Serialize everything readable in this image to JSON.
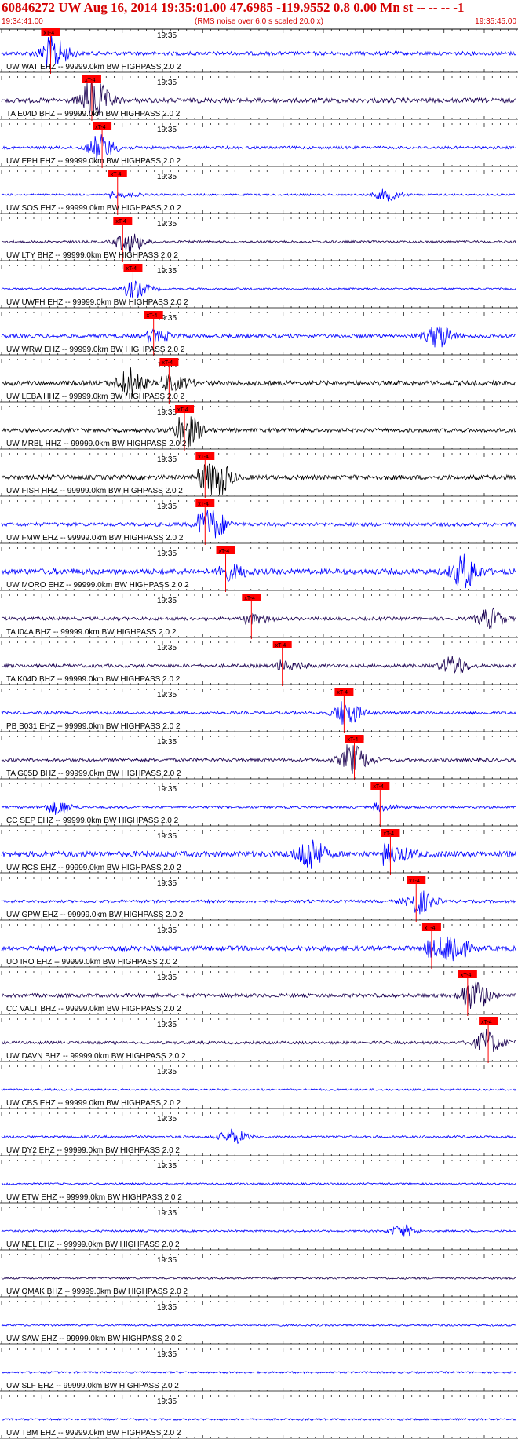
{
  "header": {
    "title": "60846272 UW Aug 16, 2014 19:35:01.00   47.6985 -119.9552  0.8 0.00 Mn st -- -- --  -1",
    "start_time": "19:34:41.00",
    "end_time": "19:35:45.00",
    "scale_note": "(RMS noise over 6.0 s scaled 20.0 x)"
  },
  "colors": {
    "header_text": "#d40000",
    "blue": "#0000ff",
    "dark": "#1a0050",
    "black": "#000000",
    "pick": "#ff0000"
  },
  "chart_data": {
    "type": "line",
    "title": "60846272 UW Aug 16, 2014 19:35:01.00   47.6985 -119.9552  0.8 0.00 Mn st -- -- --  -1",
    "x_start": "19:34:41.00",
    "x_end": "19:35:45.00",
    "x_label_per_trace": "19:35",
    "pick_label": "xT-4",
    "traces": [
      {
        "label": "UW WAT EHZ -- 99999.0km BW  HIGHPASS  2.0  2",
        "color": "blue",
        "pick": 0.08,
        "burst": 0.1,
        "amp": 0.8
      },
      {
        "label": "TA E04D BHZ -- 99999.0km BW  HIGHPASS  2.0  2",
        "color": "dark",
        "pick": 0.16,
        "burst": 0.18,
        "amp": 1.0
      },
      {
        "label": "UW EPH EHZ -- 99999.0km BW  HIGHPASS  2.0  2",
        "color": "blue",
        "pick": 0.18,
        "burst": 0.19,
        "amp": 0.6
      },
      {
        "label": "UW SOS EHZ -- 99999.0km BW  HIGHPASS  2.0  2",
        "color": "blue",
        "pick": 0.21,
        "burst": 0.75,
        "amp": 0.4
      },
      {
        "label": "UW LTY BHZ -- 99999.0km BW  HIGHPASS  2.0  2",
        "color": "dark",
        "pick": 0.22,
        "burst": 0.25,
        "amp": 0.5
      },
      {
        "label": "UW UWFH EHZ -- 99999.0km BW  HIGHPASS  2.0  2",
        "color": "blue",
        "pick": 0.24,
        "burst": 0.26,
        "amp": 0.4
      },
      {
        "label": "UW WRW EHZ -- 99999.0km BW  HIGHPASS  2.0  2",
        "color": "blue",
        "pick": 0.28,
        "burst": 0.85,
        "amp": 0.8
      },
      {
        "label": "UW LEBA HHZ -- 99999.0km BW  HIGHPASS  2.0  2",
        "color": "black",
        "pick": 0.31,
        "burst": 0.25,
        "amp": 1.0
      },
      {
        "label": "UW MRBL HHZ -- 99999.0km BW  HIGHPASS  2.0  2",
        "color": "black",
        "pick": 0.34,
        "burst": 0.36,
        "amp": 0.8
      },
      {
        "label": "UW FISH HHZ -- 99999.0km BW  HIGHPASS  2.0  2",
        "color": "black",
        "pick": 0.38,
        "burst": 0.42,
        "amp": 1.0
      },
      {
        "label": "UW FMW EHZ -- 99999.0km BW  HIGHPASS  2.0  2",
        "color": "blue",
        "pick": 0.38,
        "burst": 0.41,
        "amp": 0.8
      },
      {
        "label": "UW MORO EHZ -- 99999.0km BW  HIGHPASS  2.0  2",
        "color": "blue",
        "pick": 0.42,
        "burst": 0.9,
        "amp": 1.2
      },
      {
        "label": "TA I04A BHZ -- 99999.0km BW  HIGHPASS  2.0  2",
        "color": "dark",
        "pick": 0.47,
        "burst": 0.95,
        "amp": 0.7
      },
      {
        "label": "TA K04D BHZ -- 99999.0km BW  HIGHPASS  2.0  2",
        "color": "dark",
        "pick": 0.53,
        "burst": 0.88,
        "amp": 0.7
      },
      {
        "label": "PB B031 EHZ -- 99999.0km BW  HIGHPASS  2.0  2",
        "color": "blue",
        "pick": 0.65,
        "burst": 0.67,
        "amp": 0.6
      },
      {
        "label": "TA G05D BHZ -- 99999.0km BW  HIGHPASS  2.0  2",
        "color": "dark",
        "pick": 0.67,
        "burst": 0.68,
        "amp": 0.7
      },
      {
        "label": "CC SEP EHZ -- 99999.0km BW  HIGHPASS  2.0  2",
        "color": "blue",
        "pick": 0.72,
        "burst": 0.11,
        "amp": 0.5
      },
      {
        "label": "UW RCS EHZ -- 99999.0km BW  HIGHPASS  2.0  2",
        "color": "blue",
        "pick": 0.74,
        "burst": 0.6,
        "amp": 1.2
      },
      {
        "label": "UW GPW EHZ -- 99999.0km BW  HIGHPASS  2.0  2",
        "color": "blue",
        "pick": 0.79,
        "burst": 0.81,
        "amp": 0.6
      },
      {
        "label": "UO IRO EHZ -- 99999.0km BW  HIGHPASS  2.0  2",
        "color": "blue",
        "pick": 0.82,
        "burst": 0.88,
        "amp": 1.0
      },
      {
        "label": "CC VALT BHZ -- 99999.0km BW  HIGHPASS  2.0  2",
        "color": "dark",
        "pick": 0.89,
        "burst": 0.92,
        "amp": 0.8
      },
      {
        "label": "UW DAVN BHZ -- 99999.0km BW  HIGHPASS  2.0  2",
        "color": "dark",
        "pick": 0.93,
        "burst": 0.94,
        "amp": 0.6
      },
      {
        "label": "UW CBS EHZ -- 99999.0km BW  HIGHPASS  2.0  2",
        "color": "blue",
        "pick": null,
        "burst": null,
        "amp": 0.4
      },
      {
        "label": "UW DY2 EHZ -- 99999.0km BW  HIGHPASS  2.0  2",
        "color": "blue",
        "pick": null,
        "burst": 0.45,
        "amp": 0.5
      },
      {
        "label": "UW ETW EHZ -- 99999.0km BW  HIGHPASS  2.0  2",
        "color": "blue",
        "pick": null,
        "burst": null,
        "amp": 0.4
      },
      {
        "label": "UW NEL EHZ -- 99999.0km BW  HIGHPASS  2.0  2",
        "color": "blue",
        "pick": null,
        "burst": 0.78,
        "amp": 0.4
      },
      {
        "label": "UW OMAK BHZ -- 99999.0km BW  HIGHPASS  2.0  2",
        "color": "dark",
        "pick": null,
        "burst": null,
        "amp": 0.4
      },
      {
        "label": "UW SAW EHZ -- 99999.0km BW  HIGHPASS  2.0  2",
        "color": "blue",
        "pick": null,
        "burst": null,
        "amp": 0.4
      },
      {
        "label": "UW SLF EHZ -- 99999.0km BW  HIGHPASS  2.0  2",
        "color": "blue",
        "pick": null,
        "burst": null,
        "amp": 0.4
      },
      {
        "label": "UW TBM EHZ -- 99999.0km BW  HIGHPASS  2.0  2",
        "color": "blue",
        "pick": null,
        "burst": null,
        "amp": 0.4
      }
    ]
  }
}
